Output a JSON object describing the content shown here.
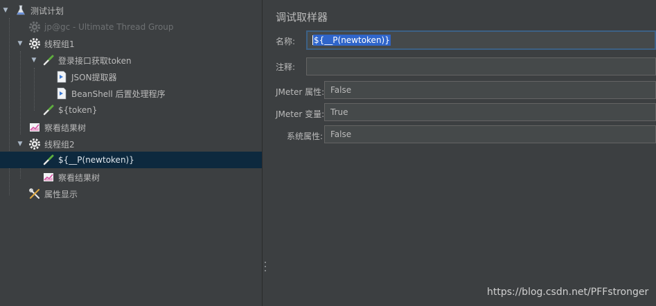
{
  "tree": {
    "nodes": [
      {
        "label": "测试计划",
        "icon": "flask-icon"
      },
      {
        "label": "jp@gc - Ultimate Thread Group",
        "icon": "gear-icon",
        "disabled": true
      },
      {
        "label": "线程组1",
        "icon": "gear-icon"
      },
      {
        "label": "登录接口获取token",
        "icon": "pipette-icon"
      },
      {
        "label": "JSON提取器",
        "icon": "post-processor-icon"
      },
      {
        "label": "BeanShell 后置处理程序",
        "icon": "post-processor-icon"
      },
      {
        "label": "${token}",
        "icon": "pipette-icon"
      },
      {
        "label": "察看结果树",
        "icon": "chart-icon"
      },
      {
        "label": "线程组2",
        "icon": "gear-icon"
      },
      {
        "label": "${__P(newtoken)}",
        "icon": "pipette-icon",
        "selected": true
      },
      {
        "label": "察看结果树",
        "icon": "chart-icon"
      },
      {
        "label": "属性显示",
        "icon": "tools-icon"
      }
    ]
  },
  "editor": {
    "title": "调试取样器",
    "name_label": "名称:",
    "name_value": "${__P(newtoken)}",
    "comment_label": "注释:",
    "comment_value": "",
    "jmeter_props_label": "JMeter 属性:",
    "jmeter_props_value": "False",
    "jmeter_vars_label": "JMeter 变量:",
    "jmeter_vars_value": "True",
    "system_props_label": "系统属性:",
    "system_props_value": "False"
  },
  "watermark": "https://blog.csdn.net/PFFstronger",
  "colors": {
    "background": "#3c3f41",
    "selection": "#0d293e",
    "field": "#45494a",
    "focus_border": "#3d6185"
  }
}
